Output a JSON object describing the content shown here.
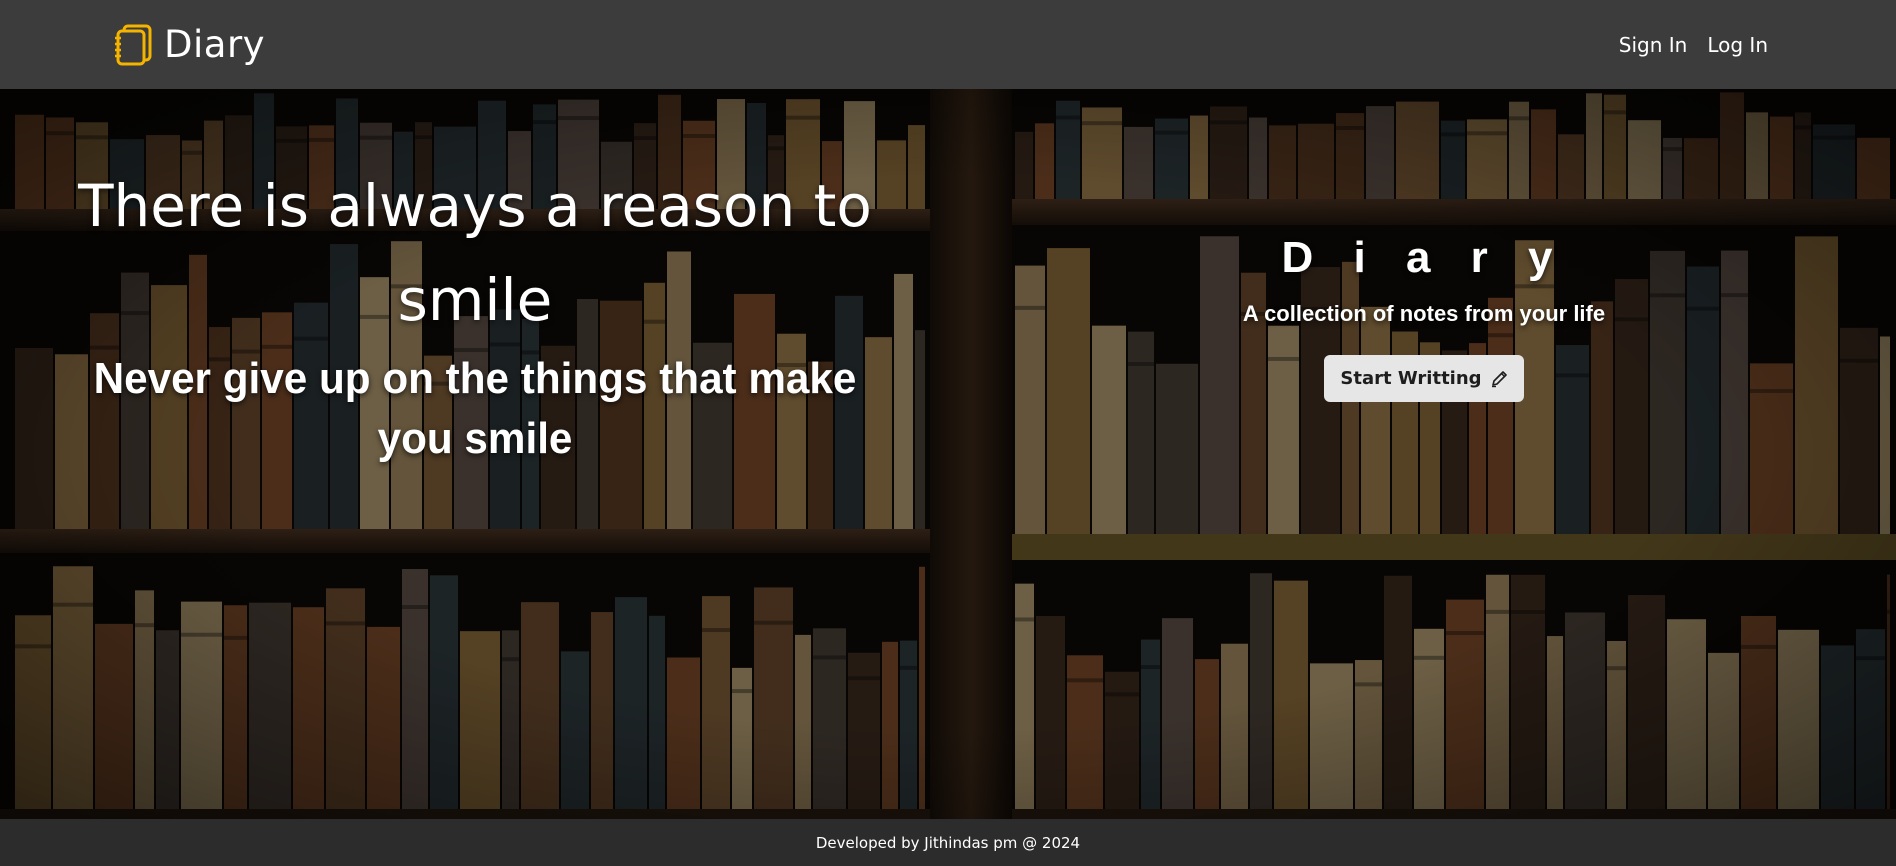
{
  "navbar": {
    "brand": "Diary",
    "brand_icon": "notebook-icon",
    "brand_color": "#f4b400",
    "links": [
      "Sign In",
      "Log In"
    ]
  },
  "hero": {
    "quote_main": "There is always a reason to smile",
    "quote_sub": "Never give up on the things that make you smile",
    "title": "D i a r y",
    "tagline": "A collection of notes from your life",
    "cta_label": "Start Writting",
    "cta_icon": "pen-icon"
  },
  "footer": {
    "text": "Developed by Jithindas pm @ 2024"
  }
}
